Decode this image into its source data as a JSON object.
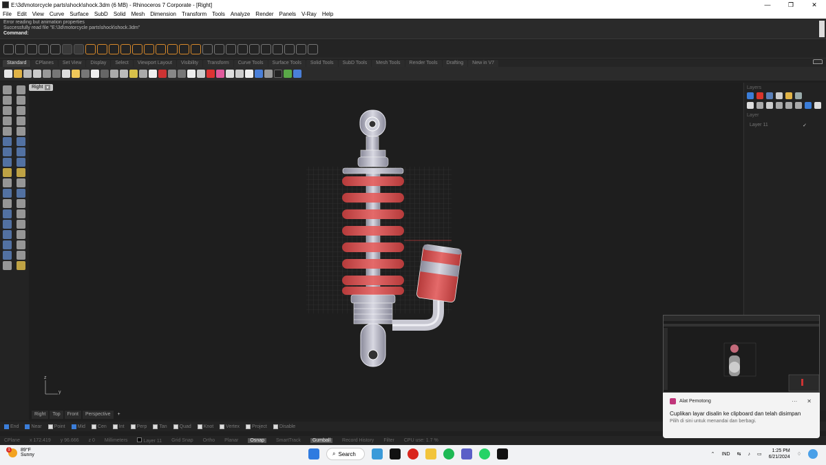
{
  "window": {
    "title": "E:\\3d\\motorcycle parts\\shock\\shock.3dm (6 MB) - Rhinoceros 7 Corporate - [Right]",
    "minimize": "—",
    "maximize": "❐",
    "close": "✕"
  },
  "menu": [
    "File",
    "Edit",
    "View",
    "Curve",
    "Surface",
    "SubD",
    "Solid",
    "Mesh",
    "Dimension",
    "Transform",
    "Tools",
    "Analyze",
    "Render",
    "Panels",
    "V-Ray",
    "Help"
  ],
  "command": {
    "history": [
      "Error reading but animation properties",
      "Successfully read file \"E:\\3d\\motorcycle parts\\shock\\shock.3dm\""
    ],
    "prompt": "Command:"
  },
  "toolbar_tabs": [
    "Standard",
    "CPlanes",
    "Set View",
    "Display",
    "Select",
    "Viewport Layout",
    "Visibility",
    "Transform",
    "Curve Tools",
    "Surface Tools",
    "Solid Tools",
    "SubD Tools",
    "Mesh Tools",
    "Render Tools",
    "Drafting",
    "New in V7"
  ],
  "viewport": {
    "label": "Right",
    "dropdown": "▾",
    "axis_z": "z",
    "axis_y": "y"
  },
  "right_panel": {
    "header": "Layers",
    "sub_header": "Layer",
    "layer_name": "Layer 11",
    "check": "✓"
  },
  "view_tabs": [
    "Right",
    "Top",
    "Front",
    "Perspective"
  ],
  "view_tabs_add": "+",
  "osnaps": [
    {
      "label": "End",
      "on": true
    },
    {
      "label": "Near",
      "on": true
    },
    {
      "label": "Point",
      "on": false
    },
    {
      "label": "Mid",
      "on": true
    },
    {
      "label": "Cen",
      "on": false
    },
    {
      "label": "Int",
      "on": false
    },
    {
      "label": "Perp",
      "on": false
    },
    {
      "label": "Tan",
      "on": false
    },
    {
      "label": "Quad",
      "on": false
    },
    {
      "label": "Knot",
      "on": false
    },
    {
      "label": "Vertex",
      "on": false
    },
    {
      "label": "Project",
      "on": false
    },
    {
      "label": "Disable",
      "on": false
    }
  ],
  "status": {
    "cplane": "CPlane",
    "x": "x 172.419",
    "y": "y 96.666",
    "z": "z 0",
    "units": "Millimeters",
    "layer": "Layer 11",
    "grid_snap": "Grid Snap",
    "ortho": "Ortho",
    "planar": "Planar",
    "osnap": "Osnap",
    "smarttrack": "SmartTrack",
    "gumball": "Gumball",
    "record_history": "Record History",
    "filter": "Filter",
    "cpu": "CPU use: 1.7 %"
  },
  "toast": {
    "app": "Alat Pemotong",
    "dots": "···",
    "close": "✕",
    "message": "Cuplikan layar disalin ke clipboard dan telah disimpan",
    "sub": "Pilih di sini untuk menandai dan berbagi."
  },
  "taskbar": {
    "temp": "89°F",
    "weather": "Sunny",
    "badge": "1",
    "search": "Search",
    "lang": "IND",
    "time": "1:25 PM",
    "date": "6/21/2024"
  }
}
